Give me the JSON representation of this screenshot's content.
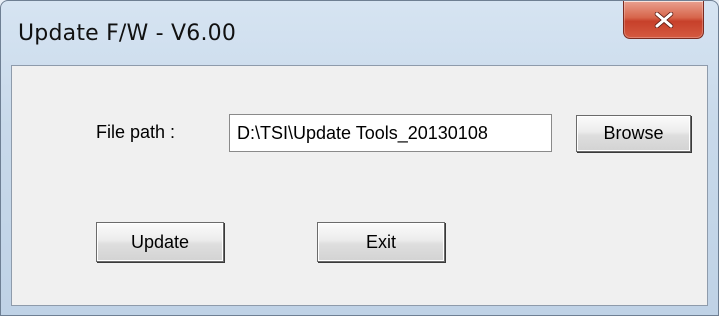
{
  "window": {
    "title": "Update F/W - V6.00",
    "close_icon": "close-icon"
  },
  "form": {
    "file_path_label": "File path :",
    "file_path_value": "D:\\TSI\\Update Tools_20130108",
    "browse_label": "Browse",
    "update_label": "Update",
    "exit_label": "Exit"
  },
  "colors": {
    "close_button": "#c7402a",
    "client_background": "#f0f0f0",
    "frame": "#c8d9ea"
  }
}
